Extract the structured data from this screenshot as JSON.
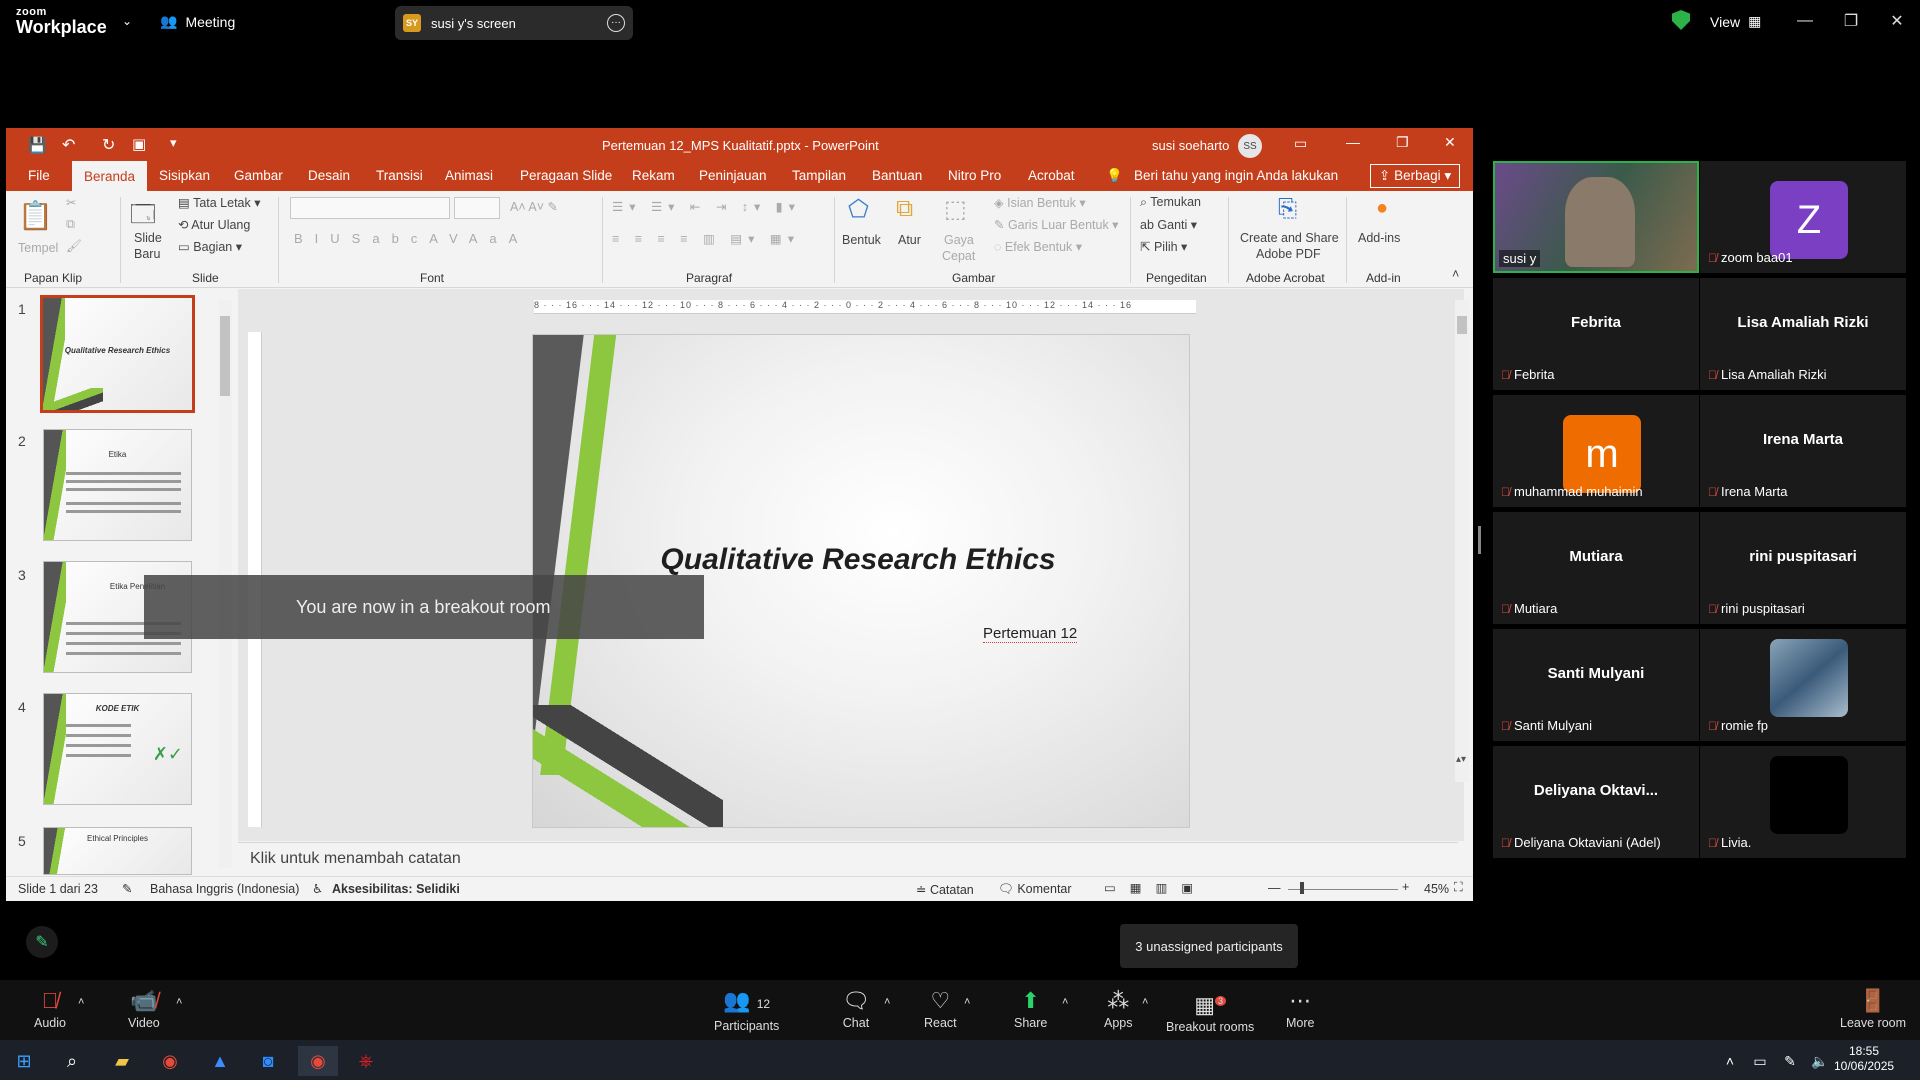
{
  "zoom": {
    "logo_top": "zoom",
    "logo_bottom": "Workplace",
    "meeting_label": "Meeting",
    "share_badge": "SY",
    "share_title": "susi y's screen",
    "view_label": "View"
  },
  "ppt": {
    "title": "Pertemuan 12_MPS Kualitatif.pptx  -  PowerPoint",
    "user": "susi soeharto",
    "user_initials": "SS",
    "menu": [
      "File",
      "Beranda",
      "Sisipkan",
      "Gambar",
      "Desain",
      "Transisi",
      "Animasi",
      "Peragaan Slide",
      "Rekam",
      "Peninjauan",
      "Tampilan",
      "Bantuan",
      "Nitro Pro",
      "Acrobat"
    ],
    "tell_me": "Beri tahu yang ingin Anda lakukan",
    "share_btn": "Berbagi",
    "groups": {
      "clipboard": "Papan Klip",
      "slide": "Slide",
      "font": "Font",
      "paragraph": "Paragraf",
      "drawing": "Gambar",
      "editing": "Pengeditan",
      "acrobat": "Adobe Acrobat",
      "addins": "Add-in"
    },
    "ribbon": {
      "paste": "Tempel",
      "new_slide_1": "Slide",
      "new_slide_2": "Baru",
      "layout": "Tata Letak",
      "reset": "Atur Ulang",
      "section": "Bagian",
      "shapes": "Bentuk",
      "arrange": "Atur",
      "quick_styles_1": "Gaya",
      "quick_styles_2": "Cepat",
      "shape_fill": "Isian Bentuk",
      "shape_outline": "Garis Luar Bentuk",
      "shape_effects": "Efek Bentuk",
      "find": "Temukan",
      "replace": "Ganti",
      "select": "Pilih",
      "acrobat_1": "Create and Share",
      "acrobat_2": "Adobe PDF",
      "addins_btn": "Add-ins"
    },
    "ruler": "8 · · · 16 · · · 14 · · · 12 · · · 10 · · · 8 · · · 6 · · · 4 · · · 2 · · · 0 · · · 2 · · · 4 · · · 6 · · · 8 · · · 10 · · · 12 · · · 14 · · · 16",
    "slides": [
      {
        "num": "1",
        "title": "Qualitative Research Ethics"
      },
      {
        "num": "2",
        "title": "Etika"
      },
      {
        "num": "3",
        "title": "Etika Penelitian"
      },
      {
        "num": "4",
        "title": "KODE ETIK"
      },
      {
        "num": "5",
        "title": "Ethical Principles"
      }
    ],
    "slide_title": "Qualitative Research Ethics",
    "slide_subtitle": "Pertemuan 12",
    "notes_placeholder": "Klik untuk menambah catatan",
    "status": {
      "slide_count": "Slide 1 dari 23",
      "language": "Bahasa Inggris (Indonesia)",
      "accessibility": "Aksesibilitas: Selidiki",
      "notes": "Catatan",
      "comments": "Komentar",
      "zoom": "45%"
    }
  },
  "toast": "You are now in a breakout room",
  "participants": [
    {
      "name": "susi y",
      "type": "video"
    },
    {
      "name": "zoom baa01",
      "type": "avatar",
      "letter": "Z",
      "color": "#7b3fc4"
    },
    {
      "name": "Febrita",
      "type": "name"
    },
    {
      "name": "Lisa Amaliah Rizki",
      "type": "name"
    },
    {
      "name": "muhammad muhaimin",
      "type": "avatar",
      "letter": "m",
      "color": "#ef6c00"
    },
    {
      "name": "Irena Marta",
      "type": "name"
    },
    {
      "name": "Mutiara",
      "type": "name"
    },
    {
      "name": "rini puspitasari",
      "type": "name"
    },
    {
      "name": "Santi Mulyani",
      "type": "name"
    },
    {
      "name": "romie fp",
      "type": "image"
    },
    {
      "name": "Deliyana Oktaviani (Adel)",
      "short": "Deliyana  Oktavi...",
      "type": "name"
    },
    {
      "name": "Livia.",
      "type": "black"
    }
  ],
  "toolbar": {
    "audio": "Audio",
    "video": "Video",
    "participants": "Participants",
    "participants_count": "12",
    "chat": "Chat",
    "react": "React",
    "share": "Share",
    "apps": "Apps",
    "breakout": "Breakout rooms",
    "breakout_badge": "3",
    "more": "More",
    "leave": "Leave room",
    "unassigned": "3 unassigned participants"
  },
  "taskbar": {
    "time": "18:55",
    "date": "10/06/2025"
  }
}
